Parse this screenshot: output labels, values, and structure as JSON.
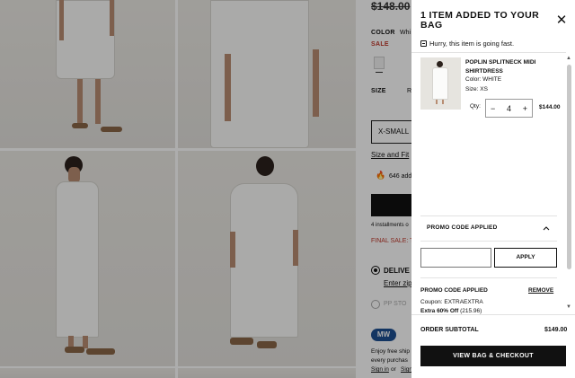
{
  "product_page": {
    "price_old": "$148.00",
    "color_label": "COLOR",
    "color_value": "Whi",
    "sale_label": "SALE",
    "size_label": "SIZE",
    "size_value": "R",
    "selected_size": "X-SMALL",
    "size_fit_link": "Size and Fit",
    "viewers_text": "646 add",
    "installments_text": "4 installments o",
    "final_sale_text": "FINAL SALE: T",
    "delivery_label": "DELIVE",
    "enter_zip_link": "Enter zip",
    "pickup_label": "PP STO",
    "mw_badge": "MW",
    "free_ship_line1": "Enjoy free ship",
    "free_ship_line2": "every purchas",
    "sign_in_link": "Sign in",
    "or_text": "or",
    "sign_up_link": "Sign"
  },
  "bag": {
    "title": "1 ITEM ADDED TO YOUR BAG",
    "hurry_text": "Hurry, this item is going fast.",
    "item": {
      "name": "POPLIN SPLITNECK MIDI SHIRTDRESS",
      "color": "Color: WHITE",
      "size": "Size: XS",
      "qty_label": "Qty:",
      "qty_minus": "−",
      "qty_value": "4",
      "qty_plus": "+",
      "price": "$144.00"
    },
    "promo": {
      "header": "PROMO CODE APPLIED",
      "input_placeholder": "",
      "apply_label": "APPLY",
      "applied_label": "PROMO CODE APPLIED",
      "remove_label": "REMOVE",
      "coupon_line": "Coupon: EXTRAEXTRA",
      "discount_bold": "Extra 60% Off",
      "discount_amount": "(215.96)"
    },
    "subtotal_label": "ORDER SUBTOTAL",
    "subtotal_value": "$149.00",
    "checkout_label": "VIEW BAG & CHECKOUT"
  }
}
